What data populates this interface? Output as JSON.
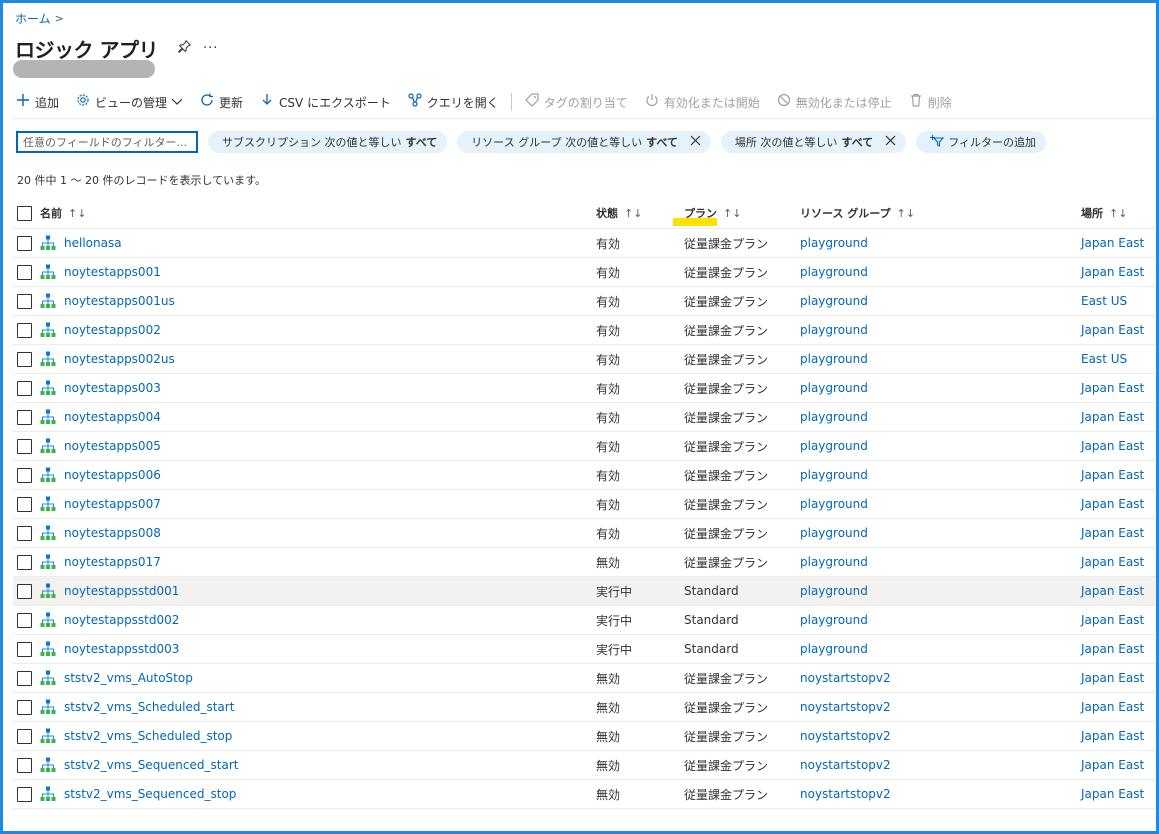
{
  "breadcrumb": {
    "home": "ホーム",
    "sep": ">"
  },
  "page": {
    "title": "ロジック アプリ",
    "pin_icon": "pin-icon",
    "more": "···"
  },
  "toolbar": {
    "add": "追加",
    "manage_view": "ビューの管理",
    "refresh": "更新",
    "export_csv": "CSV にエクスポート",
    "open_query": "クエリを開く",
    "assign_tags": "タグの割り当て",
    "enable": "有効化または開始",
    "disable": "無効化または停止",
    "delete": "削除"
  },
  "filters": {
    "search_placeholder": "任意のフィールドのフィルター...",
    "pills": [
      {
        "label": "サブスクリプション 次の値と等しい",
        "value": "すべて",
        "removable": false
      },
      {
        "label": "リソース グループ 次の値と等しい",
        "value": "すべて",
        "removable": true
      },
      {
        "label": "場所 次の値と等しい",
        "value": "すべて",
        "removable": true
      }
    ],
    "add_filter": "フィルターの追加"
  },
  "record_count": "20 件中 1 ～ 20 件のレコードを表示しています。",
  "columns": {
    "name": "名前",
    "state": "状態",
    "plan": "プラン",
    "resource_group": "リソース グループ",
    "location": "場所",
    "sort_icon": "↑↓"
  },
  "colors": {
    "accent": "#0067b8",
    "frame": "#1e88e5",
    "highlight": "#ffe100",
    "selected_row": "#f3f2f1"
  },
  "rows": [
    {
      "name": "hellonasa",
      "state": "有効",
      "plan": "従量課金プラン",
      "rg": "playground",
      "location": "Japan East"
    },
    {
      "name": "noytestapps001",
      "state": "有効",
      "plan": "従量課金プラン",
      "rg": "playground",
      "location": "Japan East"
    },
    {
      "name": "noytestapps001us",
      "state": "有効",
      "plan": "従量課金プラン",
      "rg": "playground",
      "location": "East US"
    },
    {
      "name": "noytestapps002",
      "state": "有効",
      "plan": "従量課金プラン",
      "rg": "playground",
      "location": "Japan East"
    },
    {
      "name": "noytestapps002us",
      "state": "有効",
      "plan": "従量課金プラン",
      "rg": "playground",
      "location": "East US"
    },
    {
      "name": "noytestapps003",
      "state": "有効",
      "plan": "従量課金プラン",
      "rg": "playground",
      "location": "Japan East"
    },
    {
      "name": "noytestapps004",
      "state": "有効",
      "plan": "従量課金プラン",
      "rg": "playground",
      "location": "Japan East"
    },
    {
      "name": "noytestapps005",
      "state": "有効",
      "plan": "従量課金プラン",
      "rg": "playground",
      "location": "Japan East"
    },
    {
      "name": "noytestapps006",
      "state": "有効",
      "plan": "従量課金プラン",
      "rg": "playground",
      "location": "Japan East"
    },
    {
      "name": "noytestapps007",
      "state": "有効",
      "plan": "従量課金プラン",
      "rg": "playground",
      "location": "Japan East"
    },
    {
      "name": "noytestapps008",
      "state": "有効",
      "plan": "従量課金プラン",
      "rg": "playground",
      "location": "Japan East"
    },
    {
      "name": "noytestapps017",
      "state": "無効",
      "plan": "従量課金プラン",
      "rg": "playground",
      "location": "Japan East"
    },
    {
      "name": "noytestappsstd001",
      "state": "実行中",
      "plan": "Standard",
      "rg": "playground",
      "location": "Japan East",
      "selected": true
    },
    {
      "name": "noytestappsstd002",
      "state": "実行中",
      "plan": "Standard",
      "rg": "playground",
      "location": "Japan East"
    },
    {
      "name": "noytestappsstd003",
      "state": "実行中",
      "plan": "Standard",
      "rg": "playground",
      "location": "Japan East"
    },
    {
      "name": "ststv2_vms_AutoStop",
      "state": "無効",
      "plan": "従量課金プラン",
      "rg": "noystartstopv2",
      "location": "Japan East"
    },
    {
      "name": "ststv2_vms_Scheduled_start",
      "state": "無効",
      "plan": "従量課金プラン",
      "rg": "noystartstopv2",
      "location": "Japan East"
    },
    {
      "name": "ststv2_vms_Scheduled_stop",
      "state": "無効",
      "plan": "従量課金プラン",
      "rg": "noystartstopv2",
      "location": "Japan East"
    },
    {
      "name": "ststv2_vms_Sequenced_start",
      "state": "無効",
      "plan": "従量課金プラン",
      "rg": "noystartstopv2",
      "location": "Japan East"
    },
    {
      "name": "ststv2_vms_Sequenced_stop",
      "state": "無効",
      "plan": "従量課金プラン",
      "rg": "noystartstopv2",
      "location": "Japan East"
    }
  ]
}
